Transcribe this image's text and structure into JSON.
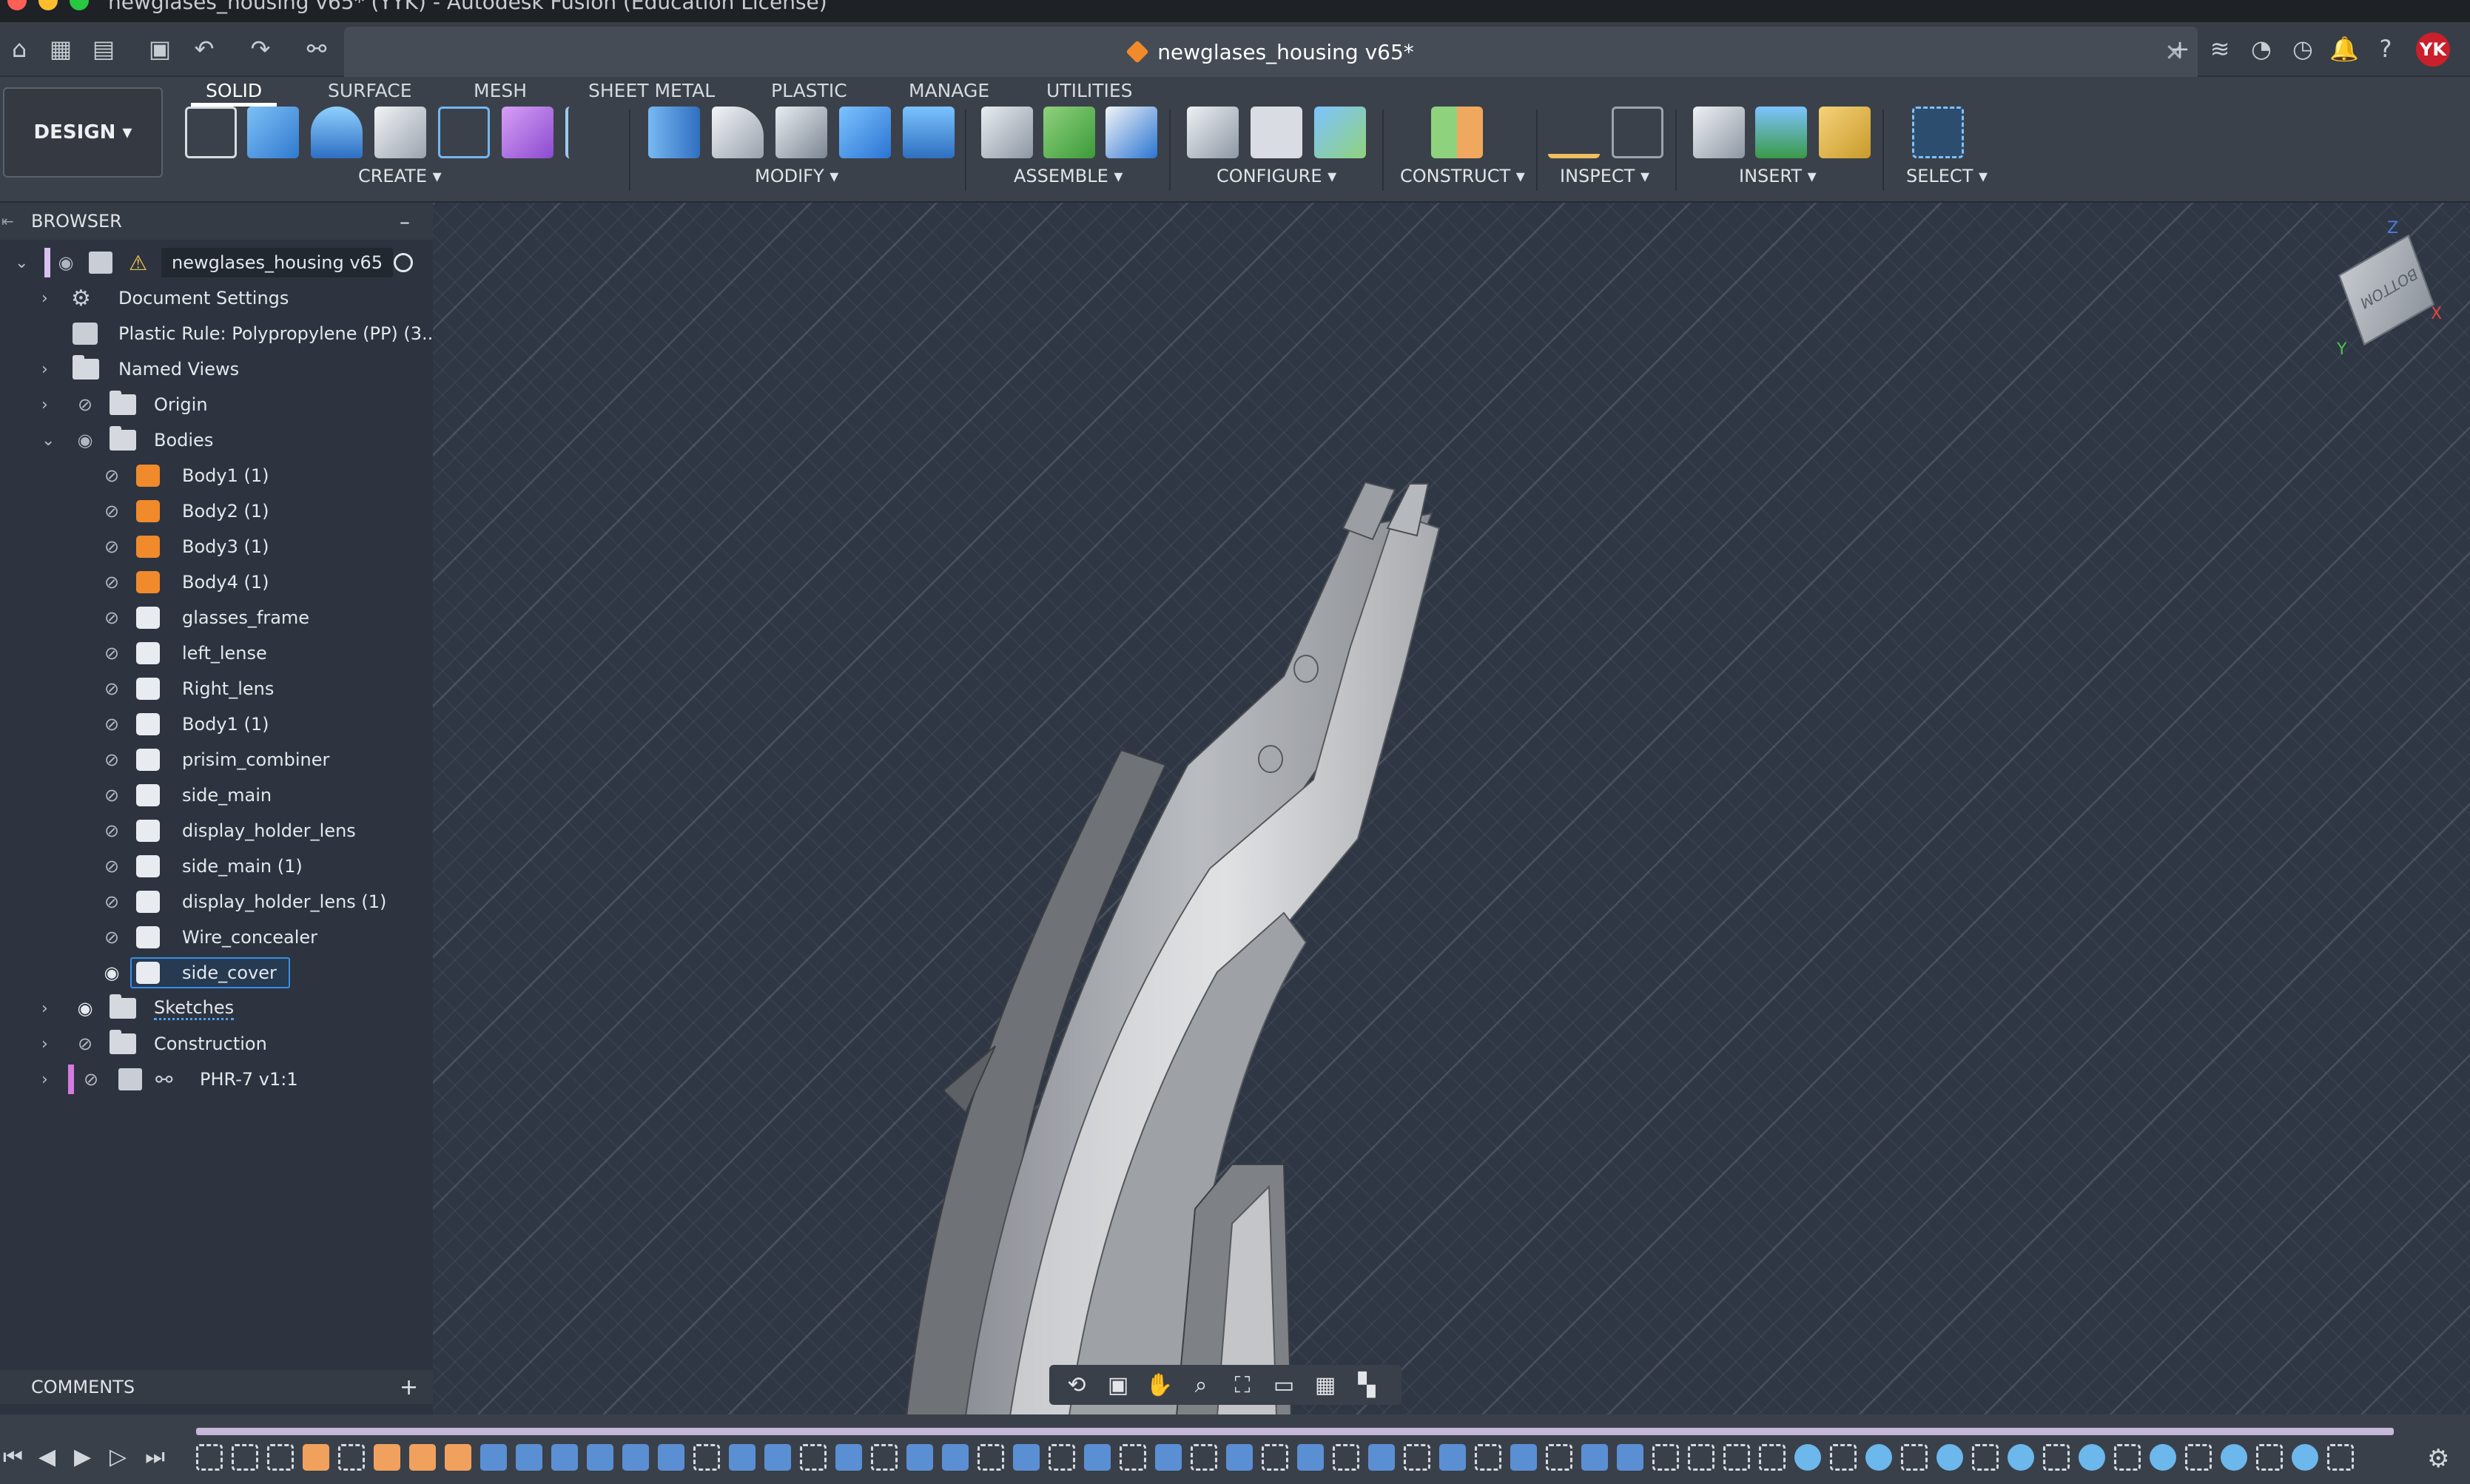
{
  "window": {
    "title": "newglases_housing v65* (YYK) - Autodesk Fusion (Education License)"
  },
  "tab": {
    "doc_title": "newglases_housing v65*",
    "avatar_initials": "YK"
  },
  "workspace": {
    "design_label": "DESIGN ▾",
    "tabs": [
      "SOLID",
      "SURFACE",
      "MESH",
      "SHEET METAL",
      "PLASTIC",
      "MANAGE",
      "UTILITIES"
    ],
    "active_tab": "SOLID",
    "groups": [
      "CREATE ▾",
      "MODIFY ▾",
      "ASSEMBLE ▾",
      "CONFIGURE ▾",
      "CONSTRUCT ▾",
      "INSPECT ▾",
      "INSERT ▾",
      "SELECT ▾"
    ]
  },
  "browser": {
    "title": "BROWSER",
    "collapse": "–",
    "root": "newglases_housing v65",
    "items": {
      "document_settings": "Document Settings",
      "plastic_rule": "Plastic Rule: Polypropylene (PP) (3...",
      "named_views": "Named Views",
      "origin": "Origin",
      "bodies": "Bodies",
      "sketches": "Sketches",
      "construction": "Construction",
      "component": "PHR-7 v1:1"
    },
    "bodies": [
      {
        "name": "Body1 (1)",
        "kind": "sheet"
      },
      {
        "name": "Body2 (1)",
        "kind": "sheet"
      },
      {
        "name": "Body3 (1)",
        "kind": "sheet"
      },
      {
        "name": "Body4 (1)",
        "kind": "sheet"
      },
      {
        "name": "glasses_frame",
        "kind": "solid"
      },
      {
        "name": "left_lense",
        "kind": "solid"
      },
      {
        "name": "Right_lens",
        "kind": "solid"
      },
      {
        "name": "Body1 (1)",
        "kind": "solid"
      },
      {
        "name": "prisim_combiner",
        "kind": "solid"
      },
      {
        "name": "side_main",
        "kind": "solid"
      },
      {
        "name": "display_holder_lens",
        "kind": "solid"
      },
      {
        "name": "side_main (1)",
        "kind": "solid"
      },
      {
        "name": "display_holder_lens (1)",
        "kind": "solid"
      },
      {
        "name": "Wire_concealer",
        "kind": "solid"
      },
      {
        "name": "side_cover",
        "kind": "solid",
        "selected": true
      }
    ]
  },
  "comments": {
    "title": "COMMENTS",
    "add": "+"
  },
  "viewcube": {
    "face": "BOTTOM",
    "axis_x": "X",
    "axis_y": "Y",
    "axis_z": "Z"
  },
  "colors": {
    "accent_selected": "#3a8ee6",
    "sheet_body": "#f08a2b",
    "background": "#2d3440"
  }
}
